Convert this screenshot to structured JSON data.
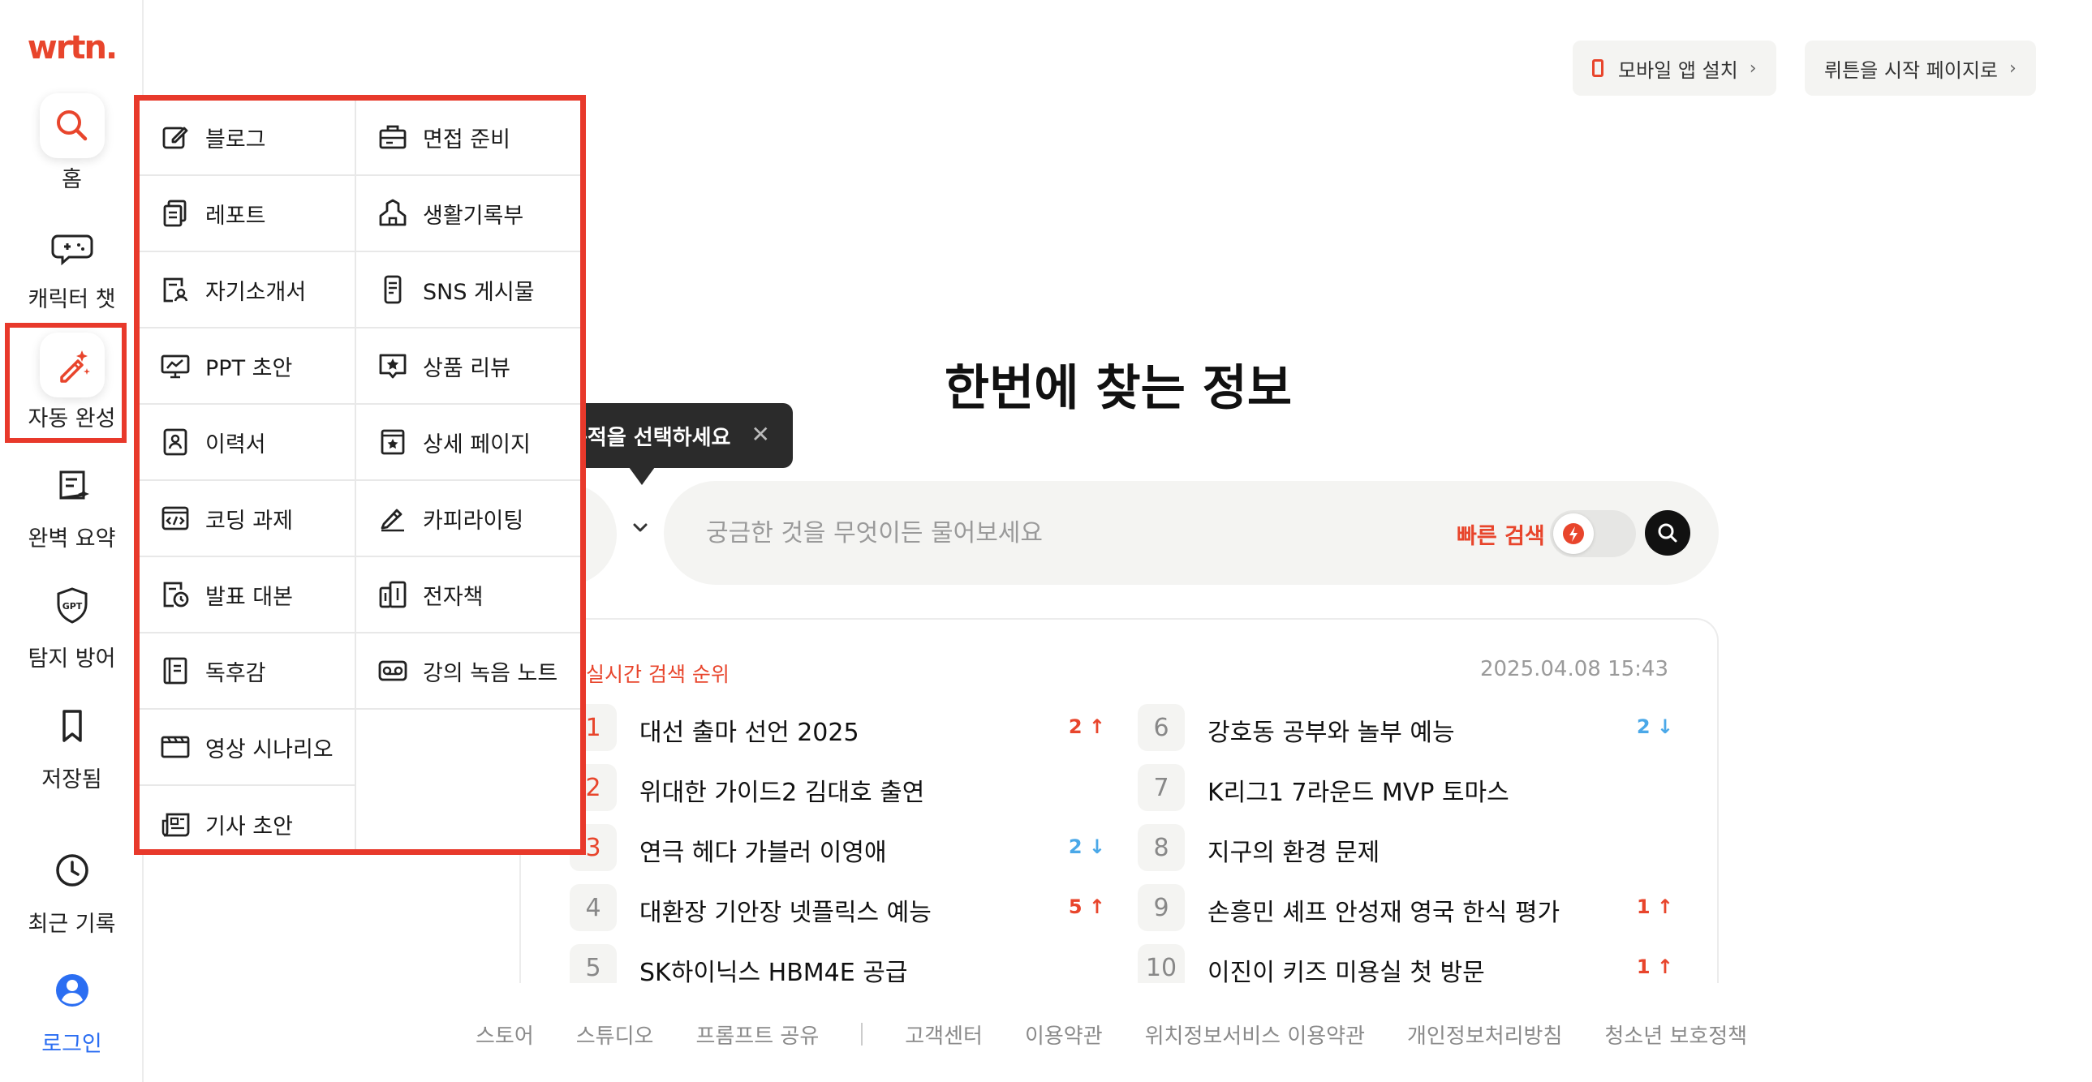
{
  "sidebar": {
    "logo": "wrtn.",
    "items": [
      {
        "label": "홈",
        "icon": "search-icon"
      },
      {
        "label": "캐릭터 챗",
        "icon": "chat-gamepad-icon"
      },
      {
        "label": "자동 완성",
        "icon": "magic-pen-icon"
      },
      {
        "label": "완벽 요약",
        "icon": "summary-icon"
      },
      {
        "label": "탐지 방어",
        "icon": "gpt-shield-icon"
      },
      {
        "label": "저장됨",
        "icon": "bookmark-icon"
      },
      {
        "label": "최근 기록",
        "icon": "clock-icon"
      },
      {
        "label": "로그인",
        "icon": "user-icon"
      }
    ]
  },
  "topbar": {
    "mobile_app": "모바일 앱 설치",
    "start_page": "뤼튼을 시작 페이지로"
  },
  "hero": {
    "title": "한번에 찾는 정보",
    "tooltip": "목적을 선택하세요",
    "search_placeholder": "궁금한 것을 무엇이든 물어보세요",
    "fast_search_label": "빠른 검색"
  },
  "trending": {
    "title": "실시간 검색 순위",
    "timestamp": "2025.04.08 15:43",
    "items": [
      {
        "rank": "1",
        "term": "대선 출마 선언 2025",
        "change": "2 ↑",
        "dir": "up"
      },
      {
        "rank": "2",
        "term": "위대한 가이드2 김대호 출연",
        "change": "",
        "dir": ""
      },
      {
        "rank": "3",
        "term": "연극 헤다 가블러 이영애",
        "change": "2 ↓",
        "dir": "down"
      },
      {
        "rank": "4",
        "term": "대환장 기안장 넷플릭스 예능",
        "change": "5 ↑",
        "dir": "up"
      },
      {
        "rank": "5",
        "term": "SK하이닉스 HBM4E 공급",
        "change": "",
        "dir": ""
      },
      {
        "rank": "6",
        "term": "강호동 공부와 놀부 예능",
        "change": "2 ↓",
        "dir": "down"
      },
      {
        "rank": "7",
        "term": "K리그1 7라운드 MVP 토마스",
        "change": "",
        "dir": ""
      },
      {
        "rank": "8",
        "term": "지구의 환경 문제",
        "change": "",
        "dir": ""
      },
      {
        "rank": "9",
        "term": "손흥민 셰프 안성재 영국 한식 평가",
        "change": "1 ↑",
        "dir": "up"
      },
      {
        "rank": "10",
        "term": "이진이 키즈 미용실 첫 방문",
        "change": "1 ↑",
        "dir": "up"
      }
    ]
  },
  "menu": {
    "left": [
      {
        "label": "블로그",
        "icon": "edit-icon"
      },
      {
        "label": "레포트",
        "icon": "documents-icon"
      },
      {
        "label": "자기소개서",
        "icon": "profile-document-icon"
      },
      {
        "label": "PPT 초안",
        "icon": "presentation-icon"
      },
      {
        "label": "이력서",
        "icon": "resume-icon"
      },
      {
        "label": "코딩 과제",
        "icon": "code-icon"
      },
      {
        "label": "발표 대본",
        "icon": "script-clock-icon"
      },
      {
        "label": "독후감",
        "icon": "book-icon"
      },
      {
        "label": "영상 시나리오",
        "icon": "video-icon"
      },
      {
        "label": "기사 초안",
        "icon": "newspaper-icon"
      }
    ],
    "right": [
      {
        "label": "면접 준비",
        "icon": "briefcase-icon"
      },
      {
        "label": "생활기록부",
        "icon": "school-icon"
      },
      {
        "label": "SNS 게시물",
        "icon": "phone-icon"
      },
      {
        "label": "상품 리뷰",
        "icon": "star-review-icon"
      },
      {
        "label": "상세 페이지",
        "icon": "product-page-icon"
      },
      {
        "label": "카피라이팅",
        "icon": "pen-icon"
      },
      {
        "label": "전자책",
        "icon": "ebook-icon"
      },
      {
        "label": "강의 녹음 노트",
        "icon": "voicemail-icon"
      }
    ]
  },
  "footer": {
    "links_left": [
      "스토어",
      "스튜디오",
      "프롬프트 공유"
    ],
    "links_right": [
      "고객센터",
      "이용약관",
      "위치정보서비스 이용약관",
      "개인정보처리방침",
      "청소년 보호정책"
    ]
  },
  "colors": {
    "accent": "#e8452c",
    "highlight_border": "#e8392b",
    "link_blue": "#2b6ef2",
    "down_blue": "#4aa8e8"
  }
}
